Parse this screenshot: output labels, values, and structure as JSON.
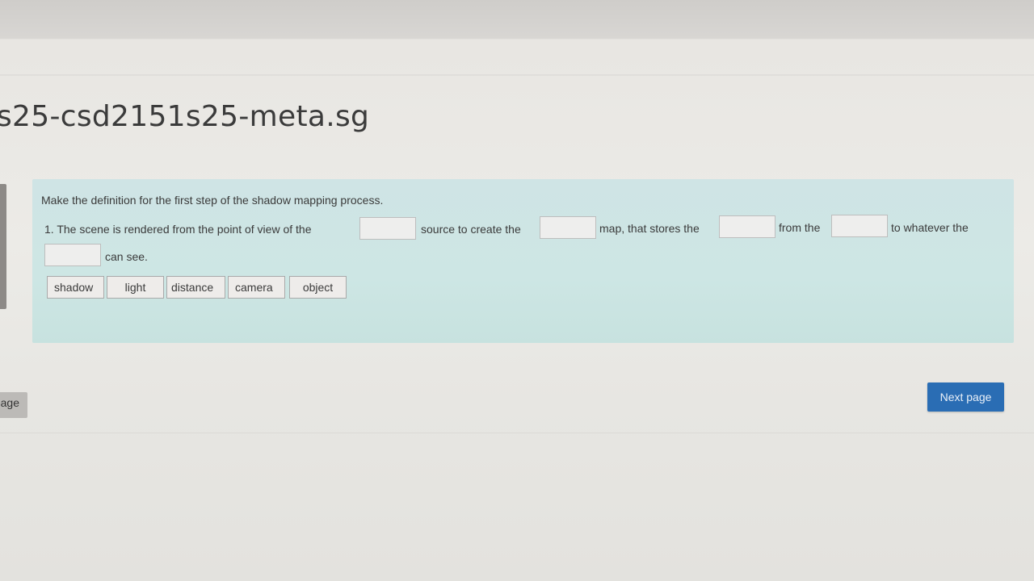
{
  "page": {
    "title": "s25-csd2151s25-meta.sg"
  },
  "question": {
    "instruction": "Make the definition for the first step of the shadow mapping process.",
    "segments": [
      "1. The scene is rendered from the point of view of the",
      "source to create the",
      "map, that stores the",
      "from the",
      "to whatever the",
      "can see."
    ],
    "choices": [
      "shadow",
      "light",
      "distance",
      "camera",
      "object"
    ]
  },
  "navigation": {
    "previous_label": "Previous page",
    "next_label": "Next page",
    "next_color": "#2a6db4"
  }
}
